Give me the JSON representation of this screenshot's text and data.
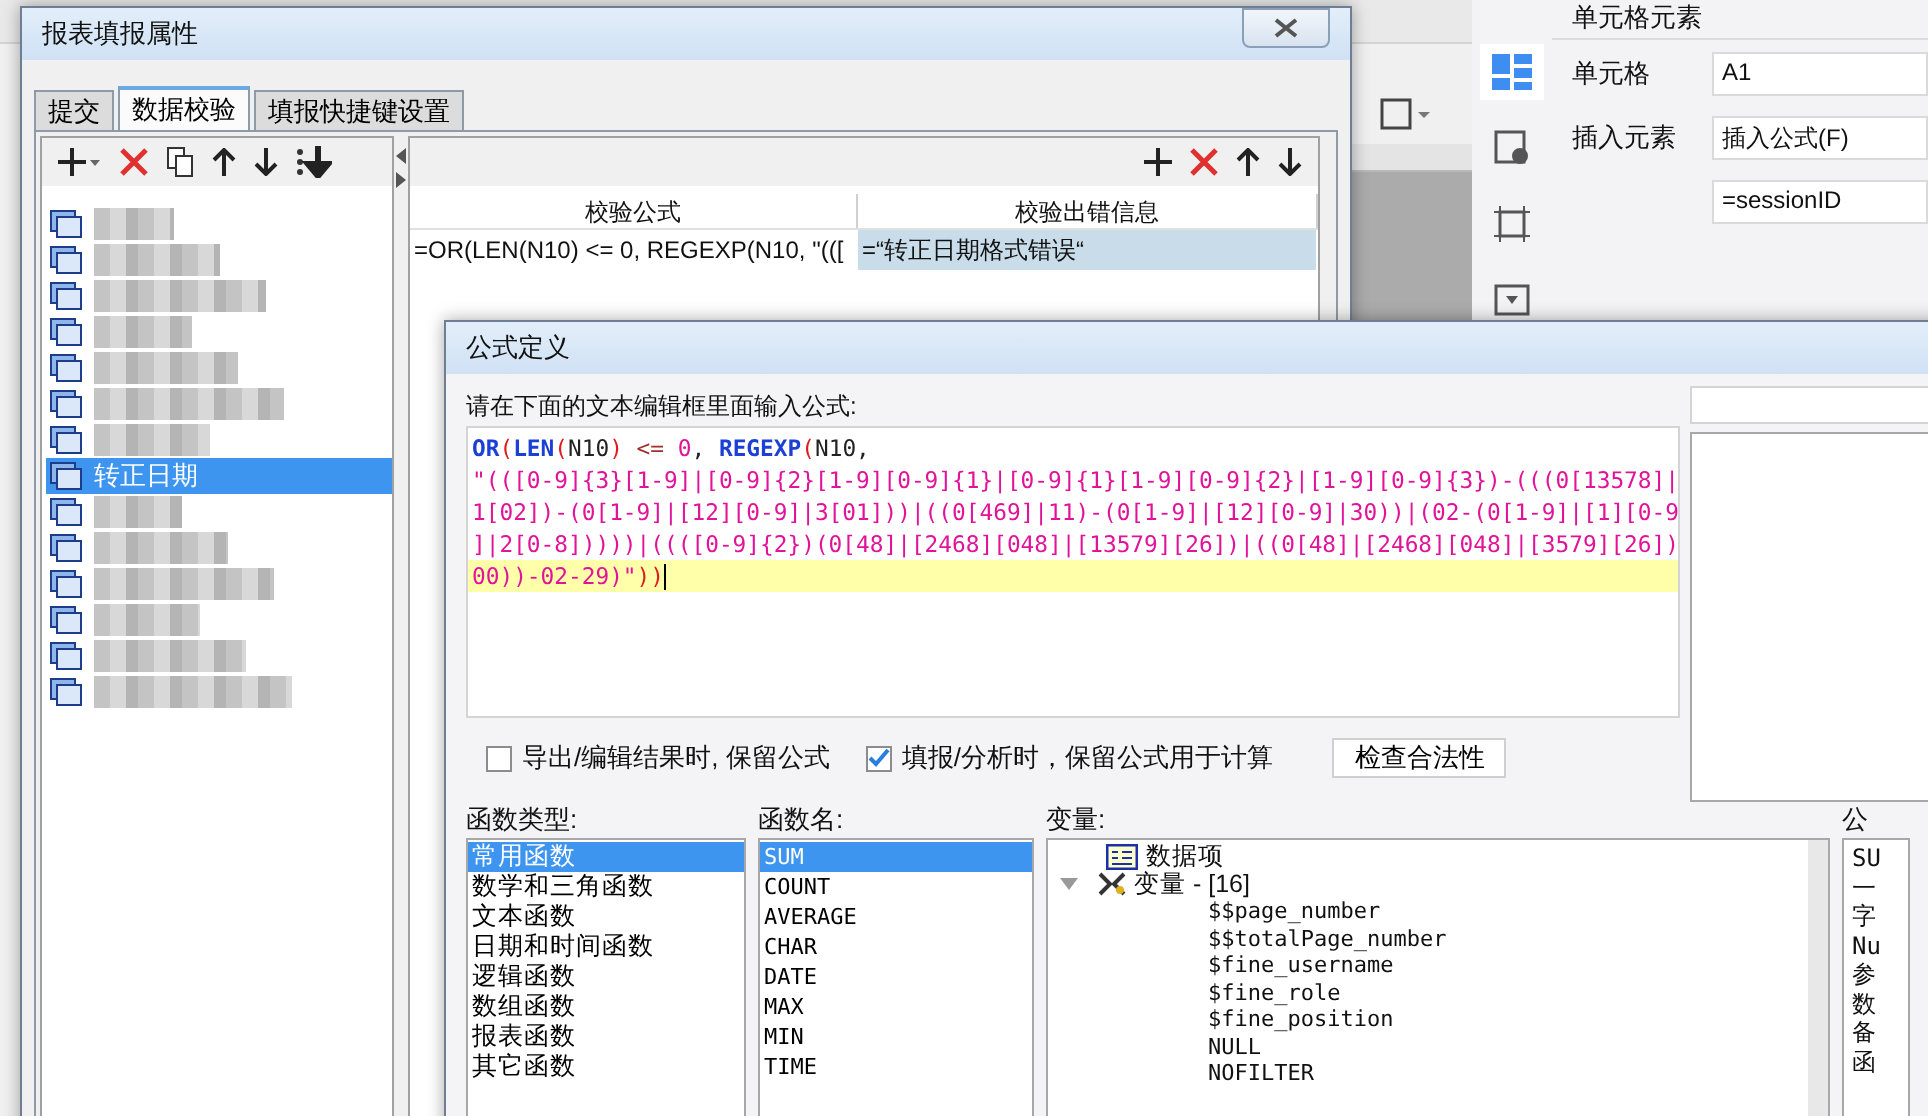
{
  "property_panel": {
    "header": "单元格元素",
    "rows": [
      {
        "label": "单元格",
        "value": "A1"
      },
      {
        "label": "插入元素",
        "value": "插入公式(F)"
      },
      {
        "label": "",
        "value": "=sessionID"
      }
    ]
  },
  "fill_dialog": {
    "title": "报表填报属性",
    "tabs": [
      {
        "label": "提交",
        "selected": false
      },
      {
        "label": "数据校验",
        "selected": true
      },
      {
        "label": "填报快捷键设置",
        "selected": false
      }
    ],
    "tree_items": [
      {
        "kind": "blurred",
        "selected": false
      },
      {
        "kind": "blurred",
        "selected": false
      },
      {
        "kind": "blurred",
        "selected": false
      },
      {
        "kind": "blurred",
        "selected": false
      },
      {
        "kind": "blurred",
        "selected": false
      },
      {
        "kind": "blurred",
        "selected": false
      },
      {
        "kind": "blurred",
        "selected": false
      },
      {
        "kind": "text",
        "label": "转正日期",
        "selected": true
      },
      {
        "kind": "blurred",
        "selected": false
      },
      {
        "kind": "blurred",
        "selected": false
      },
      {
        "kind": "blurred",
        "selected": false
      },
      {
        "kind": "blurred",
        "selected": false
      },
      {
        "kind": "blurred",
        "selected": false
      },
      {
        "kind": "blurred",
        "selected": false
      }
    ],
    "table": {
      "columns": [
        "校验公式",
        "校验出错信息"
      ],
      "rows": [
        {
          "cells": [
            "=OR(LEN(N10) <= 0, REGEXP(N10, \"(([",
            "=“转正日期格式错误“"
          ],
          "selected": true
        }
      ]
    }
  },
  "formula_dialog": {
    "title": "公式定义",
    "prompt": "请在下面的文本编辑框里面输入公式:",
    "editor_lines": [
      {
        "current": false,
        "tokens": [
          {
            "kind": "func",
            "text": "OR"
          },
          {
            "kind": "paren",
            "text": "("
          },
          {
            "kind": "func",
            "text": "LEN"
          },
          {
            "kind": "paren",
            "text": "("
          },
          {
            "kind": "plain",
            "text": "N10"
          },
          {
            "kind": "paren",
            "text": ")"
          },
          {
            "kind": "operator",
            "text": " <= "
          },
          {
            "kind": "string",
            "text": "0"
          },
          {
            "kind": "plain",
            "text": ", "
          },
          {
            "kind": "func",
            "text": "REGEXP"
          },
          {
            "kind": "paren",
            "text": "("
          },
          {
            "kind": "plain",
            "text": "N10,"
          }
        ]
      },
      {
        "current": false,
        "tokens": [
          {
            "kind": "string",
            "text": "\"(([0-9]{3}[1-9]|[0-9]{2}[1-9][0-9]{1}|[0-9]{1}[1-9][0-9]{2}|[1-9][0-9]{3})-(((0[13578]|"
          }
        ]
      },
      {
        "current": false,
        "tokens": [
          {
            "kind": "string",
            "text": "1[02])-(0[1-9]|[12][0-9]|3[01]))|((0[469]|11)-(0[1-9]|[12][0-9]|30))|(02-(0[1-9]|[1][0-9"
          }
        ]
      },
      {
        "current": false,
        "tokens": [
          {
            "kind": "string",
            "text": "]|2[0-8]))))|((([0-9]{2})(0[48]|[2468][048]|[13579][26])|((0[48]|[2468][048]|[3579][26])"
          }
        ]
      },
      {
        "current": true,
        "tokens": [
          {
            "kind": "string",
            "text": "00))-02-29)\""
          },
          {
            "kind": "paren",
            "text": "))"
          }
        ]
      }
    ],
    "options": [
      {
        "label": "导出/编辑结果时, 保留公式",
        "checked": false
      },
      {
        "label": "填报/分析时，保留公式用于计算",
        "checked": true
      }
    ],
    "check_button": "检查合法性",
    "function_types": {
      "label": "函数类型:",
      "items": [
        {
          "label": "常用函数",
          "selected": true
        },
        {
          "label": "数学和三角函数",
          "selected": false
        },
        {
          "label": "文本函数",
          "selected": false
        },
        {
          "label": "日期和时间函数",
          "selected": false
        },
        {
          "label": "逻辑函数",
          "selected": false
        },
        {
          "label": "数组函数",
          "selected": false
        },
        {
          "label": "报表函数",
          "selected": false
        },
        {
          "label": "其它函数",
          "selected": false
        }
      ]
    },
    "function_names": {
      "label": "函数名:",
      "items": [
        {
          "label": "SUM",
          "selected": true
        },
        {
          "label": "COUNT",
          "selected": false
        },
        {
          "label": "AVERAGE",
          "selected": false
        },
        {
          "label": "CHAR",
          "selected": false
        },
        {
          "label": "DATE",
          "selected": false
        },
        {
          "label": "MAX",
          "selected": false
        },
        {
          "label": "MIN",
          "selected": false
        },
        {
          "label": "TIME",
          "selected": false
        }
      ]
    },
    "variables": {
      "label": "变量:",
      "items": [
        {
          "label": "数据项",
          "kind": "data"
        },
        {
          "label": "变量 - [16]",
          "kind": "group",
          "expanded": true,
          "children": [
            {
              "label": "$$page_number"
            },
            {
              "label": "$$totalPage_number"
            },
            {
              "label": "$fine_username"
            },
            {
              "label": "$fine_role"
            },
            {
              "label": "$fine_position"
            },
            {
              "label": "NULL"
            },
            {
              "label": "NOFILTER"
            }
          ]
        }
      ]
    },
    "description": {
      "label": "公",
      "lines": [
        "SU",
        "一",
        "字",
        "Nu",
        "参",
        "数",
        "备",
        "函"
      ]
    }
  }
}
